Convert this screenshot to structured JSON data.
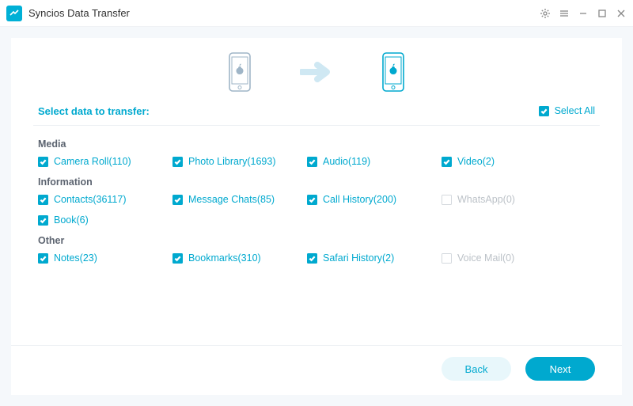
{
  "app_title": "Syncios Data Transfer",
  "section_title": "Select data to transfer:",
  "select_all_label": "Select All",
  "groups": {
    "media": {
      "title": "Media",
      "items": [
        {
          "label": "Camera Roll(110)",
          "checked": true,
          "enabled": true
        },
        {
          "label": "Photo Library(1693)",
          "checked": true,
          "enabled": true
        },
        {
          "label": "Audio(119)",
          "checked": true,
          "enabled": true
        },
        {
          "label": "Video(2)",
          "checked": true,
          "enabled": true
        }
      ]
    },
    "information": {
      "title": "Information",
      "items": [
        {
          "label": "Contacts(36117)",
          "checked": true,
          "enabled": true
        },
        {
          "label": "Message Chats(85)",
          "checked": true,
          "enabled": true
        },
        {
          "label": "Call History(200)",
          "checked": true,
          "enabled": true
        },
        {
          "label": "WhatsApp(0)",
          "checked": false,
          "enabled": false
        },
        {
          "label": "Book(6)",
          "checked": true,
          "enabled": true
        }
      ]
    },
    "other": {
      "title": "Other",
      "items": [
        {
          "label": "Notes(23)",
          "checked": true,
          "enabled": true
        },
        {
          "label": "Bookmarks(310)",
          "checked": true,
          "enabled": true
        },
        {
          "label": "Safari History(2)",
          "checked": true,
          "enabled": true
        },
        {
          "label": "Voice Mail(0)",
          "checked": false,
          "enabled": false
        }
      ]
    }
  },
  "buttons": {
    "back": "Back",
    "next": "Next"
  },
  "colors": {
    "accent": "#00a9cf",
    "disabled": "#bcc2c8"
  }
}
